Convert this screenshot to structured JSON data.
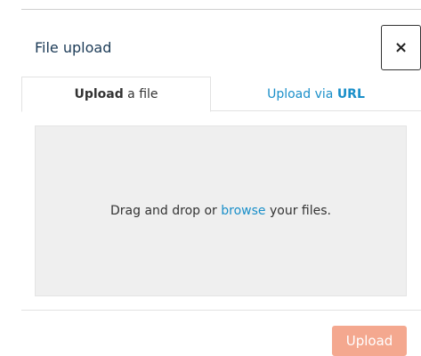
{
  "modal": {
    "title": "File upload",
    "close_label": "×"
  },
  "tabs": [
    {
      "bold": "Upload",
      "rest": " a file",
      "active": true
    },
    {
      "prefix": "Upload via ",
      "bold": "URL",
      "active": false
    }
  ],
  "dropzone": {
    "text_before": "Drag and drop or ",
    "link": "browse",
    "text_after": " your files."
  },
  "footer": {
    "upload_label": "Upload",
    "upload_disabled": true
  },
  "colors": {
    "title": "#1c3b57",
    "link": "#1a8fc9",
    "dropzone_bg": "#efefef",
    "upload_button": "#f4a88f"
  }
}
